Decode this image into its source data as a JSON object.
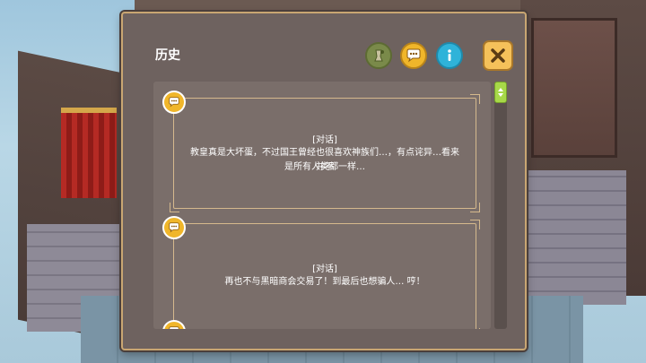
{
  "history_panel": {
    "title": "历史",
    "header_icons": {
      "voice": "voice-replay-icon",
      "chat": "chat-bubble-icon",
      "info": "info-icon",
      "close": "close-icon"
    },
    "entries": [
      {
        "tag": "[对话]",
        "lines": [
          "教皇真是大坏蛋，不过国王曾经也很喜欢神族们…，有点诧异…看来并不",
          "是所有人类都一样…"
        ]
      },
      {
        "tag": "[对话]",
        "lines": [
          "再也不与黑暗商会交易了！到最后也想骗人… 哼！"
        ]
      }
    ]
  },
  "colors": {
    "panel_bg": "#6e625f",
    "panel_border": "#c9a672",
    "accent_yellow": "#f0b62a",
    "info_blue": "#2fb3d9",
    "scroll_green": "#a7d948"
  }
}
